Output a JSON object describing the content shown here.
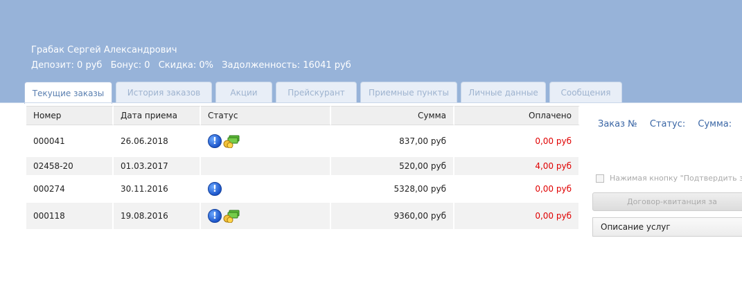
{
  "user": {
    "name": "Грабак Сергей Александрович",
    "deposit": "Депозит: 0 руб",
    "bonus": "Бонус: 0",
    "discount": "Скидка: 0%",
    "debt": "Задолженность: 16041 руб"
  },
  "tabs": [
    {
      "label": "Текущие заказы",
      "active": true
    },
    {
      "label": "История заказов"
    },
    {
      "label": "Акции"
    },
    {
      "label": "Прейскурант"
    },
    {
      "label": "Приемные пункты"
    },
    {
      "label": "Личные данные"
    },
    {
      "label": "Сообщения"
    }
  ],
  "table": {
    "headers": {
      "number": "Номер",
      "date": "Дата приема",
      "status": "Статус",
      "sum": "Сумма",
      "paid": "Оплачено"
    },
    "rows": [
      {
        "number": "000041",
        "date": "26.06.2018",
        "icons": [
          "info-icon",
          "money-icon"
        ],
        "sum": "837,00 руб",
        "paid": "0,00 руб"
      },
      {
        "number": "02458-20",
        "date": "01.03.2017",
        "icons": [],
        "sum": "520,00 руб",
        "paid": "4,00 руб"
      },
      {
        "number": "000274",
        "date": "30.11.2016",
        "icons": [
          "info-icon"
        ],
        "sum": "5328,00 руб",
        "paid": "0,00 руб"
      },
      {
        "number": "000118",
        "date": "19.08.2016",
        "icons": [
          "info-icon",
          "money-icon"
        ],
        "sum": "9360,00 руб",
        "paid": "0,00 руб"
      }
    ]
  },
  "side": {
    "order_label": "Заказ №",
    "status_label": "Статус:",
    "sum_label": "Сумма:",
    "agree_text": "Нажимая кнопку \"Подтвердить за",
    "contract_button": "Договор-квитанция за",
    "services_label": "Описание услуг"
  },
  "colors": {
    "header_bg": "#97b3d9",
    "paid_red": "#e00000",
    "link_blue": "#3a66a5"
  }
}
